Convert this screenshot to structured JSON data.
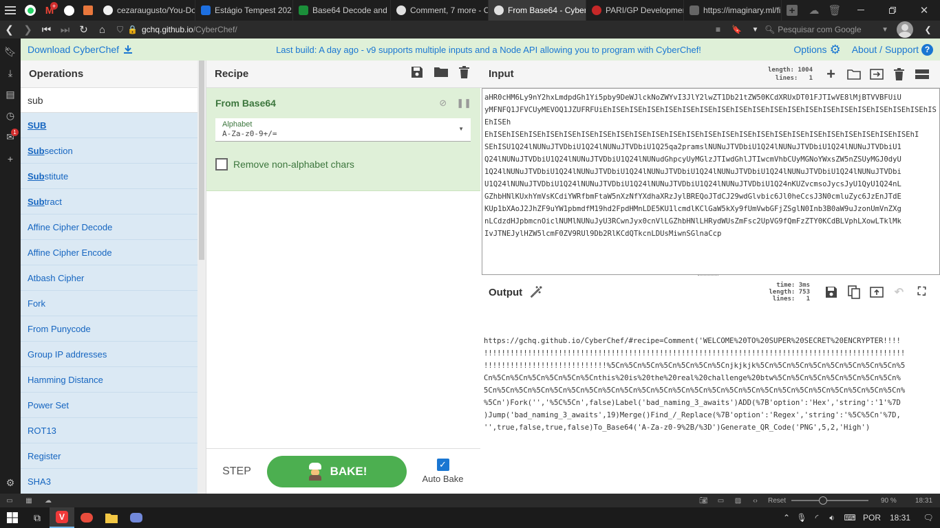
{
  "browser": {
    "tabs": [
      {
        "label": "cezaraugusto/You-Don",
        "color": "#f0f0f0",
        "active": false
      },
      {
        "label": "Estágio Tempest 2021",
        "color": "#1d6fe0",
        "active": false
      },
      {
        "label": "Base64 Decode and En",
        "color": "#1b8f3a",
        "active": false
      },
      {
        "label": "Comment, 7 more - Cy",
        "color": "#e0e0e0",
        "active": false
      },
      {
        "label": "From Base64 - CyberCh",
        "color": "#e0e0e0",
        "active": true
      },
      {
        "label": "PARI/GP Development",
        "color": "#c62828",
        "active": false
      },
      {
        "label": "https://imaginary.ml/fi",
        "color": "#666666",
        "active": false
      }
    ],
    "mail_badge": "+",
    "address_host": "gchq.github.io",
    "address_path": "/CyberChef/",
    "search_placeholder": "Pesquisar com Google",
    "sidebar_badge": "1"
  },
  "banner": {
    "download_label": "Download CyberChef",
    "message": "Last build: A day ago - v9 supports multiple inputs and a Node API allowing you to program with CyberChef!",
    "options_label": "Options",
    "about_label": "About / Support"
  },
  "operations": {
    "title": "Operations",
    "search_value": "sub",
    "items": [
      {
        "match": "SUB",
        "rest": ""
      },
      {
        "match": "Sub",
        "rest": "section"
      },
      {
        "match": "Sub",
        "rest": "stitute"
      },
      {
        "match": "Sub",
        "rest": "tract"
      },
      {
        "match": "",
        "rest": "Affine Cipher Decode"
      },
      {
        "match": "",
        "rest": "Affine Cipher Encode"
      },
      {
        "match": "",
        "rest": "Atbash Cipher"
      },
      {
        "match": "",
        "rest": "Fork"
      },
      {
        "match": "",
        "rest": "From Punycode"
      },
      {
        "match": "",
        "rest": "Group IP addresses"
      },
      {
        "match": "",
        "rest": "Hamming Distance"
      },
      {
        "match": "",
        "rest": "Power Set"
      },
      {
        "match": "",
        "rest": "ROT13"
      },
      {
        "match": "",
        "rest": "Register"
      },
      {
        "match": "",
        "rest": "SHA3"
      }
    ]
  },
  "recipe": {
    "title": "Recipe",
    "operation_name": "From Base64",
    "alphabet_label": "Alphabet",
    "alphabet_value": "A-Za-z0-9+/=",
    "remove_label": "Remove non-alphabet chars",
    "step_label": "STEP",
    "bake_label": "BAKE!",
    "auto_bake_label": "Auto Bake",
    "auto_bake_checked": true
  },
  "input": {
    "title": "Input",
    "length_label": "length:",
    "length_value": "1004",
    "lines_label": "lines:",
    "lines_value": "1",
    "lines_text": [
      "aHR0cHM6Ly9nY2hxLmdpdGh1Yi5pby9DeWJlckNoZWYvI3JlY2lwZT1Db21tZW50KCdXRUxDT01FJTIwVE8lMjBTVVBFUiU",
      "yMFNFQ1JFVCUyMEVOQ1JZUFRFUiEhISEhISEhISEhISEhISEhISEhISEhISEhISEhISEhISEhISEhISEhISEhISEhISEhISEhISEhISEhISEh",
      "EhISEhISEhISEhISEhISEhISEhISEhISEhISEhISEhISEhISEhISEhISEhISEhISEhISEhISEhISEhISEhISEhISEhISEhISEhI",
      "SEhISU1Q24lNUNuJTVDbiU1Q24lNUNuJTVDbiU1Q25qa2pramslNUNuJTVDbiU1Q24lNUNuJTVDbiU1Q24lNUNuJTVDbiU1",
      "Q24lNUNuJTVDbiU1Q24lNUNuJTVDbiU1Q24lNUNudGhpcyUyMGlzJTIwdGhlJTIwcmVhbCUyMGNoYWxsZW5nZSUyMGJ0dyU",
      "1Q24lNUNuJTVDbiU1Q24lNUNuJTVDbiU1Q24lNUNuJTVDbiU1Q24lNUNuJTVDbiU1Q24lNUNuJTVDbiU1Q24lNUNuJTVDbi",
      "U1Q24lNUNuJTVDbiU1Q24lNUNuJTVDbiU1Q24lNUNuJTVDbiU1Q24lNUNuJTVDbiU1Q24nKUZvcmsoJycsJyU1QyU1Q24nL",
      "GZhbHNlKUxhYmVsKCdiYWRfbmFtaW5nXzNfYXdhaXRzJylBREQoJTdCJ29wdGlvbic6Jl0heCcsJ3N0cmluZyc6JzEnJTdE",
      "KUp1bXAoJ2JhZF9uYW1pbmdfM19hd2FpdHMnLDE5KU1lcmdlKClGaW5kXy9fUmVwbGFjZSglN0Inb3B0aW9uJzonUmVnZXg",
      "nLCdzdHJpbmcnOiclNUMlNUNuJyU3RCwnJyx0cnVlLGZhbHNlLHRydWUsZmFsc2UpVG9fQmFzZTY0KCdBLVphLXowLTklMk",
      "IvJTNEJylHZW5lcmF0ZV9RUl9Db2RlKCdQTkcnLDUsMiwnSGlnaCcp"
    ]
  },
  "output": {
    "title": "Output",
    "time_label": "time:",
    "time_value": "3ms",
    "length_label": "length:",
    "length_value": "753",
    "lines_label": "lines:",
    "lines_value": "1",
    "lines_text": [
      "https://gchq.github.io/CyberChef/#recipe=Comment('WELCOME%20TO%20SUPER%20SECRET%20ENCRYPTER!!!!",
      "!!!!!!!!!!!!!!!!!!!!!!!!!!!!!!!!!!!!!!!!!!!!!!!!!!!!!!!!!!!!!!!!!!!!!!!!!!!!!!!!!!!!!!!!!!!!!!!!",
      "!!!!!!!!!!!!!!!!!!!!!!!!!!!!%5Cn%5Cn%5Cn%5Cn%5Cn%5Cn%5Cnjkjkjk%5Cn%5Cn%5Cn%5Cn%5Cn%5Cn%5Cn%5Cn%5",
      "Cn%5Cn%5Cn%5Cn%5Cn%5Cn%5Cnthis%20is%20the%20real%20challenge%20btw%5Cn%5Cn%5Cn%5Cn%5Cn%5Cn%5Cn%",
      "5Cn%5Cn%5Cn%5Cn%5Cn%5Cn%5Cn%5Cn%5Cn%5Cn%5Cn%5Cn%5Cn%5Cn%5Cn%5Cn%5Cn%5Cn%5Cn%5Cn%5Cn%5Cn%5Cn%5Cn%",
      "%5Cn')Fork('','%5C%5Cn',false)Label('bad_naming_3_awaits')ADD(%7B'option':'Hex','string':'1'%7D",
      ")Jump('bad_naming_3_awaits',19)Merge()Find_/_Replace(%7B'option':'Regex','string':'%5C%5Cn'%7D,",
      "'',true,false,true,false)To_Base64('A-Za-z0-9%2B/%3D')Generate_QR_Code('PNG',5,2,'High')"
    ]
  },
  "statusbar": {
    "reset_label": "Reset",
    "zoom_percent": "90 %",
    "zoom_fraction": 0.4,
    "time": "18:31"
  },
  "taskbar": {
    "language": "POR",
    "time": "18:31"
  },
  "colors": {
    "banner_bg": "#dff0d8",
    "recipe_op_bg": "#dff0d8",
    "ops_item_bg": "#dbe9f4",
    "bake_green": "#4caf50",
    "link_blue": "#1976d2"
  }
}
